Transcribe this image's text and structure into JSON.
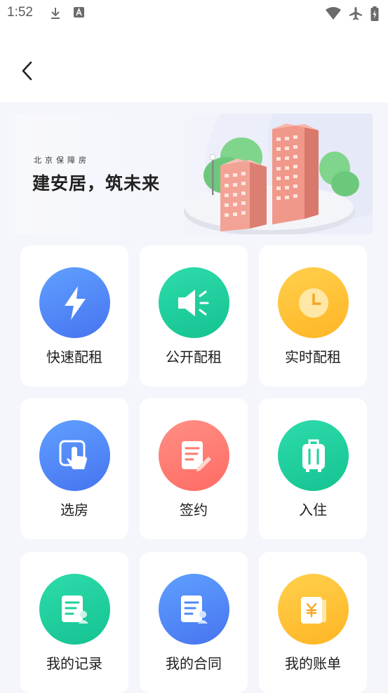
{
  "status_bar": {
    "time": "1:52",
    "icons": [
      "download-icon",
      "font-a-icon",
      "wifi-icon",
      "airplane-icon",
      "battery-charging-icon"
    ]
  },
  "header": {
    "back_icon": "chevron-left-icon"
  },
  "banner": {
    "subtitle": "北京保障房",
    "title": "建安居，筑未来"
  },
  "grid": {
    "items": [
      {
        "label": "快速配租",
        "icon": "lightning-icon",
        "color": "#4f86f7"
      },
      {
        "label": "公开配租",
        "icon": "speaker-icon",
        "color": "#1ecf9f"
      },
      {
        "label": "实时配租",
        "icon": "clock-icon",
        "color": "#ffc12e"
      },
      {
        "label": "选房",
        "icon": "touch-select-icon",
        "color": "#4f86f7"
      },
      {
        "label": "签约",
        "icon": "sign-document-icon",
        "color": "#ff7a6e"
      },
      {
        "label": "入住",
        "icon": "luggage-icon",
        "color": "#1ecf9f"
      },
      {
        "label": "我的记录",
        "icon": "record-document-icon",
        "color": "#1ecf9f"
      },
      {
        "label": "我的合同",
        "icon": "contract-document-icon",
        "color": "#4f86f7"
      },
      {
        "label": "我的账单",
        "icon": "bill-yuan-icon",
        "color": "#ffc12e"
      }
    ]
  }
}
